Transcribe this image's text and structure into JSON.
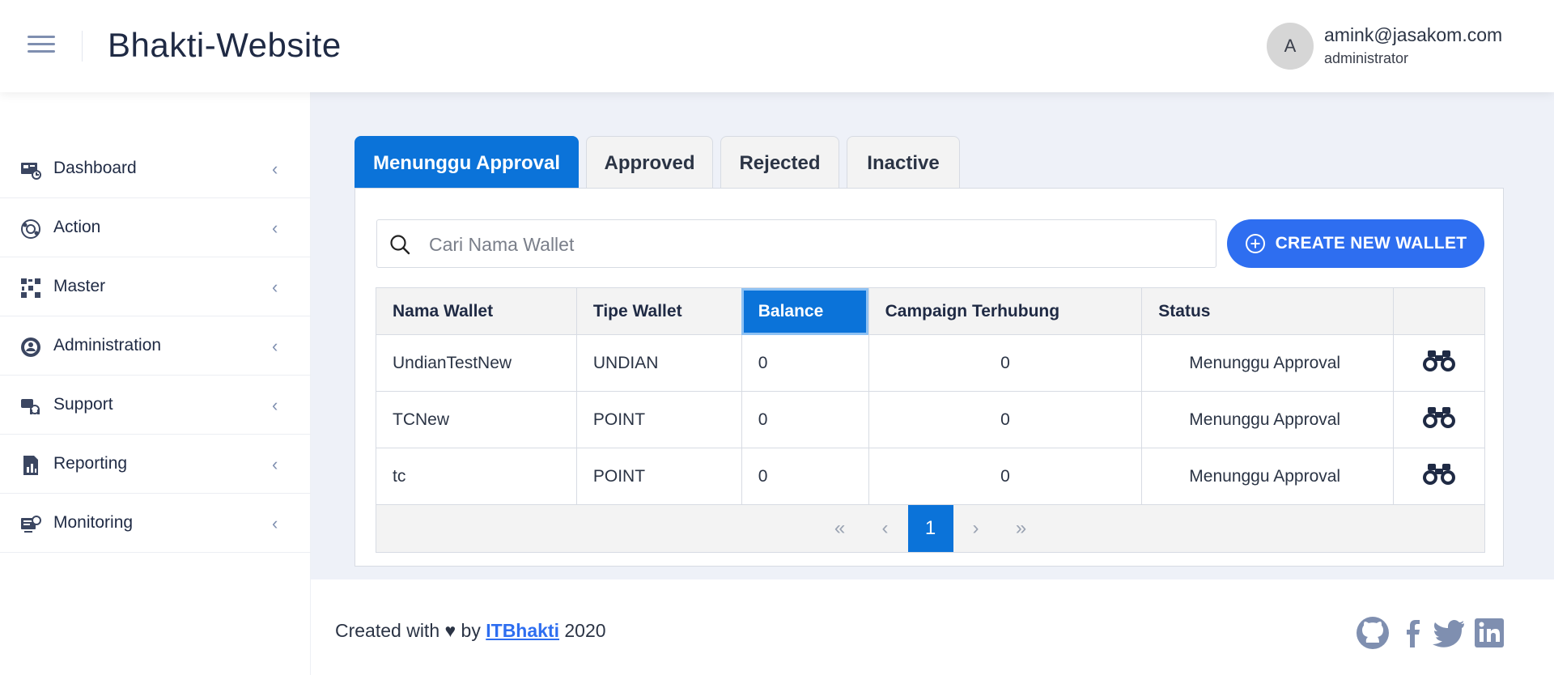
{
  "header": {
    "title": "Bhakti-Website",
    "avatar_initial": "A",
    "user_email": "amink@jasakom.com",
    "user_role": "administrator"
  },
  "sidebar": {
    "items": [
      {
        "label": "Dashboard",
        "icon": "dashboard-icon"
      },
      {
        "label": "Action",
        "icon": "action-icon"
      },
      {
        "label": "Master",
        "icon": "master-icon"
      },
      {
        "label": "Administration",
        "icon": "administration-icon"
      },
      {
        "label": "Support",
        "icon": "support-icon"
      },
      {
        "label": "Reporting",
        "icon": "reporting-icon"
      },
      {
        "label": "Monitoring",
        "icon": "monitoring-icon"
      }
    ]
  },
  "tabs": [
    {
      "label": "Menunggu Approval",
      "active": true
    },
    {
      "label": "Approved",
      "active": false
    },
    {
      "label": "Rejected",
      "active": false
    },
    {
      "label": "Inactive",
      "active": false
    }
  ],
  "search": {
    "placeholder": "Cari Nama Wallet",
    "value": ""
  },
  "create_button": {
    "label": "CREATE NEW WALLET"
  },
  "table": {
    "headers": [
      "Nama Wallet",
      "Tipe Wallet",
      "Balance",
      "Campaign Terhubung",
      "Status",
      ""
    ],
    "sorted_column": "Balance",
    "rows": [
      {
        "nama": "UndianTestNew",
        "tipe": "UNDIAN",
        "balance": "0",
        "campaign": "0",
        "status": "Menunggu Approval"
      },
      {
        "nama": "TCNew",
        "tipe": "POINT",
        "balance": "0",
        "campaign": "0",
        "status": "Menunggu Approval"
      },
      {
        "nama": "tc",
        "tipe": "POINT",
        "balance": "0",
        "campaign": "0",
        "status": "Menunggu Approval"
      }
    ]
  },
  "pagination": {
    "first": "«",
    "prev": "‹",
    "current": "1",
    "next": "›",
    "last": "»"
  },
  "footer": {
    "prefix": "Created with ♥ by",
    "link": "ITBhakti",
    "year": "2020",
    "social": [
      "github-icon",
      "facebook-icon",
      "twitter-icon",
      "linkedin-icon"
    ]
  },
  "colors": {
    "primary": "#0b73d9",
    "button": "#2e6ef0",
    "background": "#eef1f8"
  }
}
